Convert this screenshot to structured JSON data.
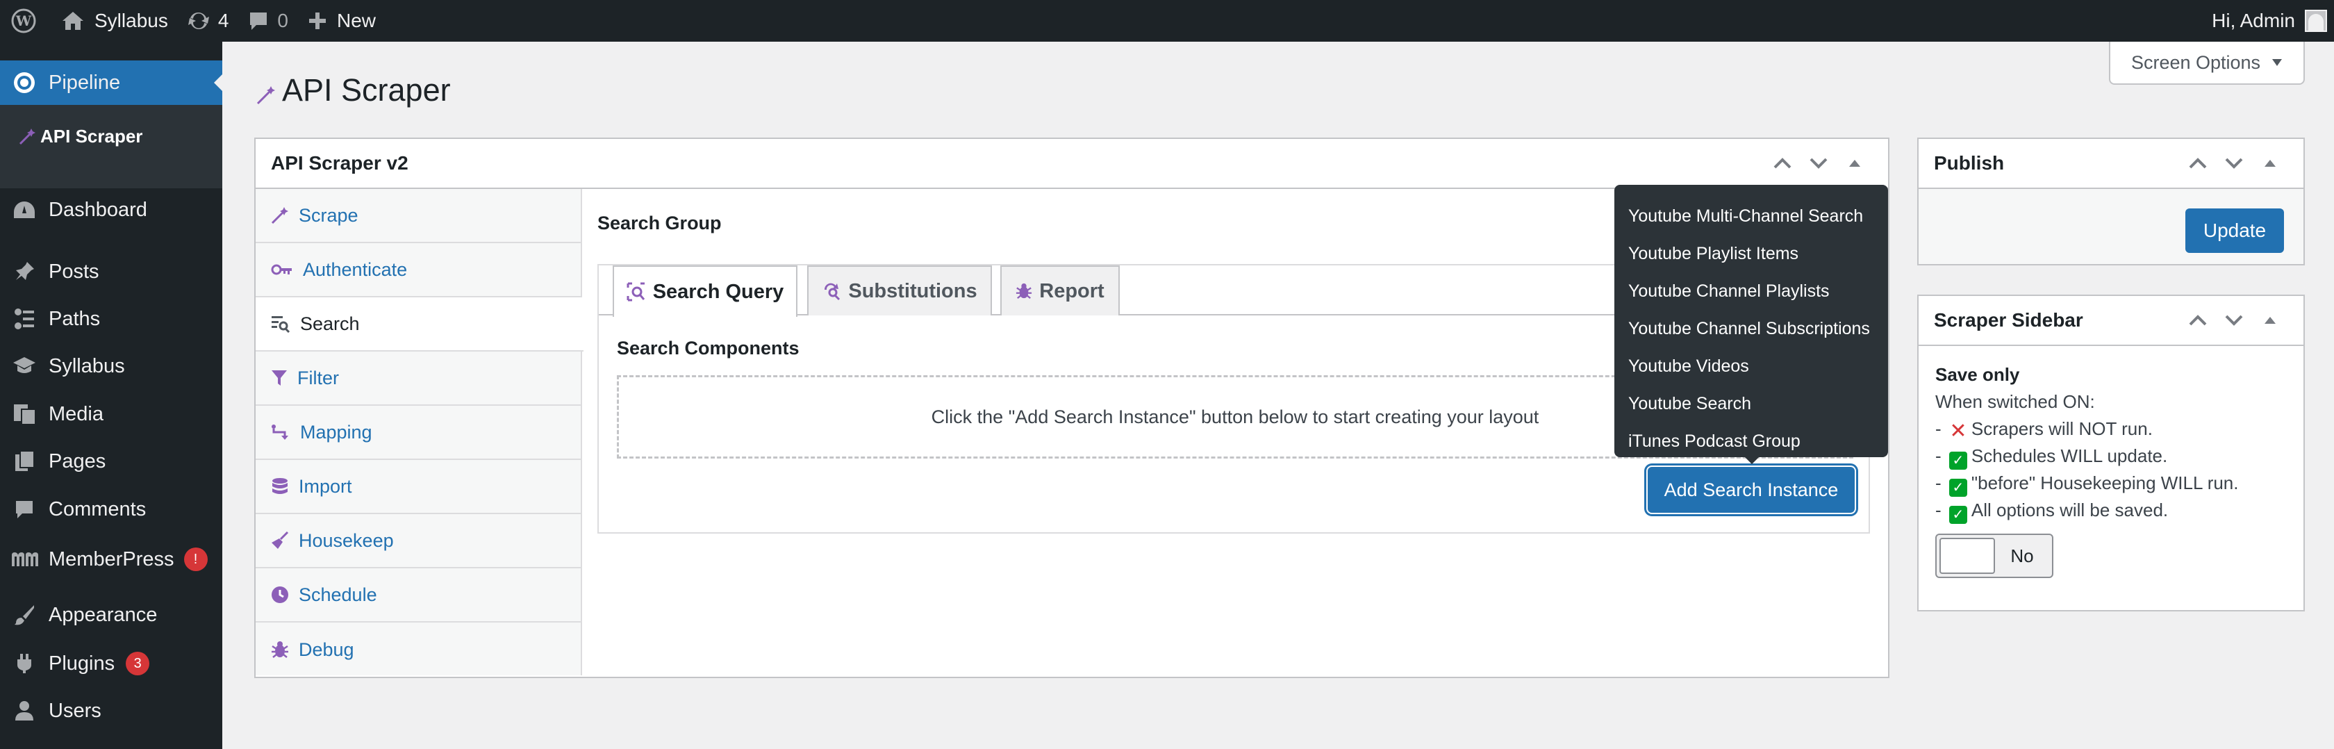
{
  "adminbar": {
    "site_name": "Syllabus",
    "updates_count": "4",
    "comments_count": "0",
    "new_label": "New",
    "greeting": "Hi, Admin"
  },
  "sidebar": {
    "items": [
      {
        "label": "Pipeline",
        "icon": "pipeline-icon"
      },
      {
        "label": "Dashboard",
        "icon": "dashboard-icon"
      },
      {
        "label": "Posts",
        "icon": "pin-icon"
      },
      {
        "label": "Paths",
        "icon": "paths-icon"
      },
      {
        "label": "Syllabus",
        "icon": "graduation-cap-icon"
      },
      {
        "label": "Media",
        "icon": "media-icon"
      },
      {
        "label": "Pages",
        "icon": "page-icon"
      },
      {
        "label": "Comments",
        "icon": "comment-icon"
      },
      {
        "label": "MemberPress",
        "icon": "memberpress-icon",
        "badge": "!"
      },
      {
        "label": "Appearance",
        "icon": "brush-icon"
      },
      {
        "label": "Plugins",
        "icon": "plugin-icon",
        "badge": "3"
      },
      {
        "label": "Users",
        "icon": "users-icon"
      }
    ],
    "submenu": {
      "label": "API Scraper"
    }
  },
  "page": {
    "title": "API Scraper",
    "screen_options": "Screen Options"
  },
  "main_box": {
    "title": "API Scraper v2",
    "vtabs": [
      {
        "label": "Scrape",
        "icon": "wand-icon"
      },
      {
        "label": "Authenticate",
        "icon": "key-icon"
      },
      {
        "label": "Search",
        "icon": "search-list-icon"
      },
      {
        "label": "Filter",
        "icon": "filter-icon"
      },
      {
        "label": "Mapping",
        "icon": "mapping-icon"
      },
      {
        "label": "Import",
        "icon": "database-icon"
      },
      {
        "label": "Housekeep",
        "icon": "broom-icon"
      },
      {
        "label": "Schedule",
        "icon": "clock-icon"
      },
      {
        "label": "Debug",
        "icon": "bug-icon"
      }
    ],
    "group_title": "Search Group",
    "tabs": [
      {
        "label": "Search Query",
        "icon": "search-query-icon"
      },
      {
        "label": "Substitutions",
        "icon": "substitutions-icon"
      },
      {
        "label": "Report",
        "icon": "report-icon"
      }
    ],
    "components_title": "Search Components",
    "empty_message": "Click the \"Add Search Instance\" button below to start creating your layout",
    "add_button": "Add Search Instance",
    "dropdown": [
      "Youtube Multi-Channel Search",
      "Youtube Playlist Items",
      "Youtube Channel Playlists",
      "Youtube Channel Subscriptions",
      "Youtube Videos",
      "Youtube Search",
      "iTunes Podcast Group"
    ]
  },
  "publish": {
    "title": "Publish",
    "update_button": "Update"
  },
  "scraper_sidebar": {
    "title": "Scraper Sidebar",
    "save_only": "Save only",
    "when": "When switched ON:",
    "lines": [
      "Scrapers will NOT run.",
      "Schedules WILL update.",
      "\"before\" Housekeeping WILL run.",
      "All options will be saved."
    ],
    "toggle_label": "No"
  },
  "colors": {
    "accent": "#2271b1",
    "adminbar": "#1d2327",
    "icon_purple": "#8c5fb8",
    "danger": "#d63638",
    "success": "#00a32a"
  }
}
